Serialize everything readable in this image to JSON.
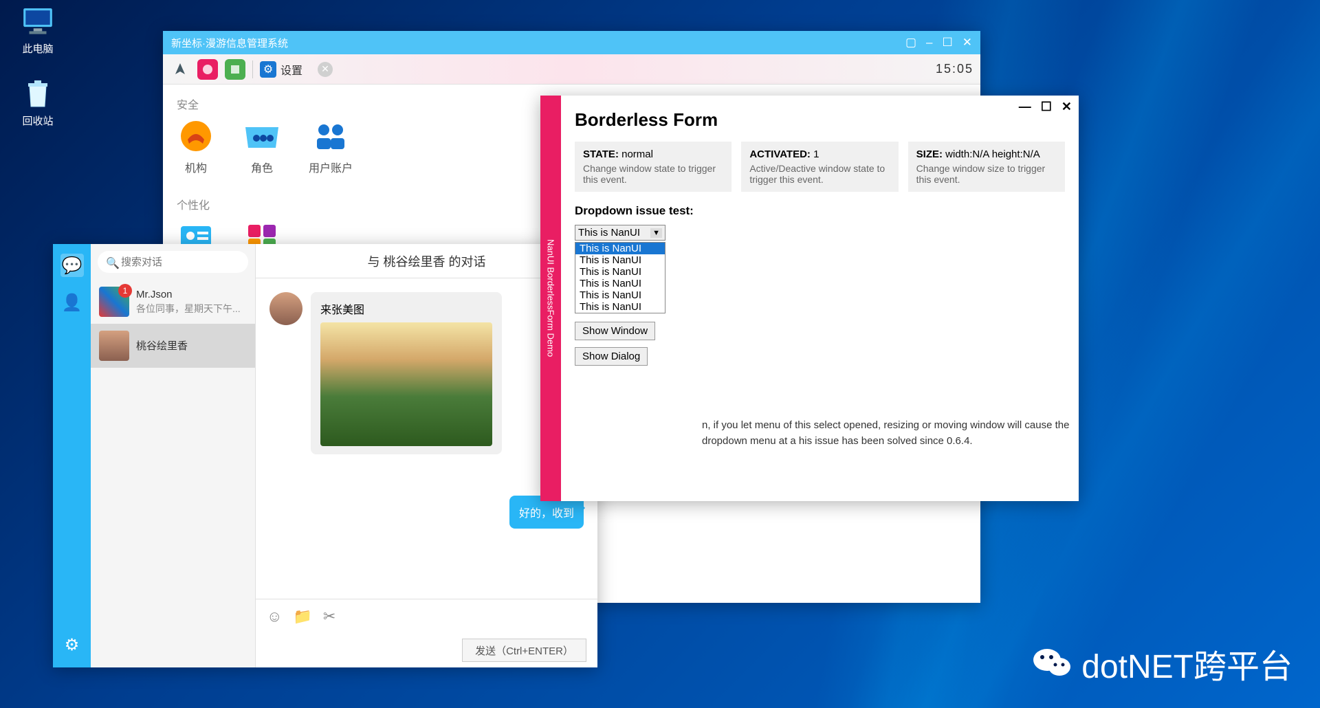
{
  "desktop": {
    "computer": "此电脑",
    "recycle": "回收站"
  },
  "mgmt": {
    "title": "新坐标·漫游信息管理系统",
    "toolbar": {
      "settings": "设置",
      "time": "15:05"
    },
    "section_security": "安全",
    "security_items": [
      "机构",
      "角色",
      "用户账户"
    ],
    "section_personal": "个性化"
  },
  "chat": {
    "search_placeholder": "搜索对话",
    "contacts": [
      {
        "name": "Mr.Json",
        "preview": "各位同事，星期天下午...",
        "badge": "1"
      },
      {
        "name": "桃谷绘里香",
        "preview": ""
      }
    ],
    "header": "与 桃谷绘里香 的对话",
    "header_btn": "–",
    "msg_received": "来张美图",
    "msg_sent": "好的，收到",
    "send_btn": "发送（Ctrl+ENTER）"
  },
  "borderless": {
    "sidebar": "NanUI BorderlessForm Demo",
    "title": "Borderless Form",
    "status": [
      {
        "label": "STATE:",
        "value": "normal",
        "desc": "Change window state to trigger this event."
      },
      {
        "label": "ACTIVATED:",
        "value": "1",
        "desc": "Active/Deactive window state to trigger this event."
      },
      {
        "label": "SIZE:",
        "value": "width:N/A height:N/A",
        "desc": "Change window size to trigger this event."
      }
    ],
    "dropdown_label": "Dropdown issue test:",
    "dropdown_selected": "This is NanUI",
    "dropdown_options": [
      "This is NanUI",
      "This is NanUI",
      "This is NanUI",
      "This is NanUI",
      "This is NanUI",
      "This is NanUI"
    ],
    "dropdown_note": "n, if you let menu of this select opened, resizing or moving window will cause the dropdown menu at a his issue has been solved since 0.6.4.",
    "show_window": "Show Window",
    "show_dialog": "Show Dialog"
  },
  "watermark": "dotNET跨平台"
}
